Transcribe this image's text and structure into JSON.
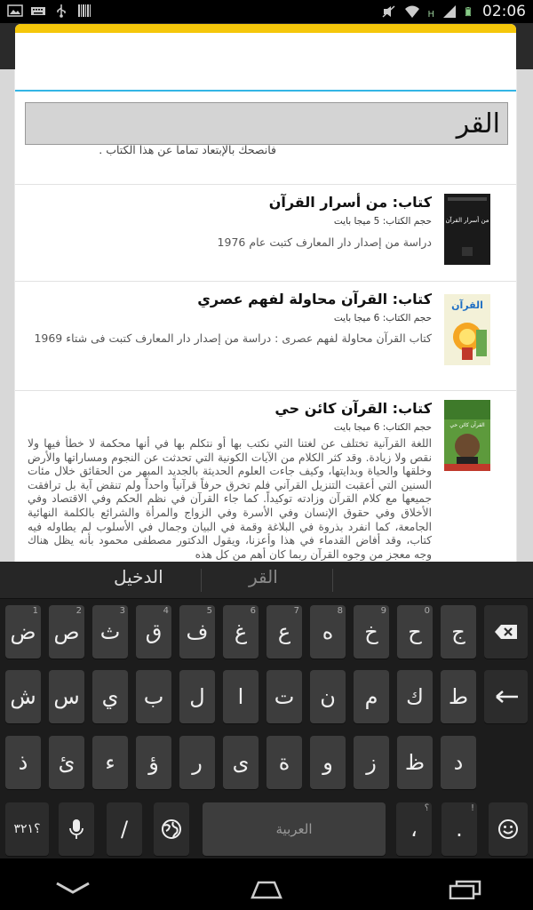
{
  "status_bar": {
    "time": "02:06",
    "network_type": "H",
    "icons": [
      "picture-icon",
      "keyboard-icon",
      "usb-icon",
      "barcode-icon",
      "mute-icon",
      "wifi-icon",
      "signal-icon",
      "battery-icon"
    ]
  },
  "search": {
    "value": "القر"
  },
  "results": {
    "partial_text": "فأنصحك بالإبتعاد تماماً عن هذا الكتاب .",
    "items": [
      {
        "title": "كتاب: من أسرار القرآن",
        "size": "حجم الكتاب: 5 ميجا بايت",
        "desc": "دراسة من إصدار دار المعارف كتبت عام 1976",
        "thumb_text": "من أسرار القرآن"
      },
      {
        "title": "كتاب: القرآن محاولة لفهم عصري",
        "size": "حجم الكتاب: 6 ميجا بايت",
        "desc": "كتاب القرآن محاولة لفهم عصرى : دراسة من إصدار دار المعارف كتبت فى شتاء 1969",
        "thumb_text": "القرآن"
      },
      {
        "title": "كتاب: القرآن كائن حي",
        "size": "حجم الكتاب: 6 ميجا بايت",
        "desc": "اللغة القرآنية تختلف عن لغتنا التي نكتب بها أو نتكلم بها في أنها محكمة لا خطأ فيها ولا نقص ولا زيادة. وقد كثر الكلام من الآيات الكونية التي تحدثت عن النجوم ومساراتها والأرض وخلقها والحياة وبدايتها، وكيف جاءت العلوم الحديثة بالجديد المبهر من الحقائق خلال مئات السنين التي أعقبت التنزيل القرآني فلم تخرق حرفاً قرآنياً واحداً ولم تنقض آية بل ترافقت جميعها مع كلام القرآن وزادته توكيداً. كما جاء القرآن في نظم الحكم وفي الاقتصاد وفي الأخلاق وفي حقوق الإنسان وفي الأسرة وفي الزواج والمرأة والشرائع بالكلمة النهائية الجامعة، كما انفرد بذروة في البلاغة وقمة في البيان وجمال في الأسلوب لم يطاوله فيه كتاب، وقد أفاض القدماء في هذا وأعزنا، ويقول الدكتور مصطفى محمود بأنه يظل هناك وجه معجز من وجوه القرآن ربما كان أهم من كل هذه",
        "thumb_text": "القرآن كائن حي"
      }
    ]
  },
  "keyboard": {
    "suggestions": [
      "القر",
      "الدخيل"
    ],
    "row1": [
      {
        "label": "ض",
        "hint": "1"
      },
      {
        "label": "ص",
        "hint": "2"
      },
      {
        "label": "ث",
        "hint": "3"
      },
      {
        "label": "ق",
        "hint": "4"
      },
      {
        "label": "ف",
        "hint": "5"
      },
      {
        "label": "غ",
        "hint": "6"
      },
      {
        "label": "ع",
        "hint": "7"
      },
      {
        "label": "ه",
        "hint": "8"
      },
      {
        "label": "خ",
        "hint": "9"
      },
      {
        "label": "ح",
        "hint": "0"
      },
      {
        "label": "ج",
        "hint": ""
      }
    ],
    "row2": [
      "ش",
      "س",
      "ي",
      "ب",
      "ل",
      "ا",
      "ت",
      "ن",
      "م",
      "ك",
      "ط"
    ],
    "row3": [
      "ذ",
      "ئ",
      "ء",
      "ؤ",
      "ر",
      "ى",
      "ة",
      "و",
      "ز",
      "ظ",
      "د"
    ],
    "symbols_label": "؟٣٢١",
    "slash_label": "/",
    "space_label": "العربية",
    "comma_label": "،",
    "period_label": ".",
    "comma_hint": "؟",
    "period_hint": "!"
  }
}
